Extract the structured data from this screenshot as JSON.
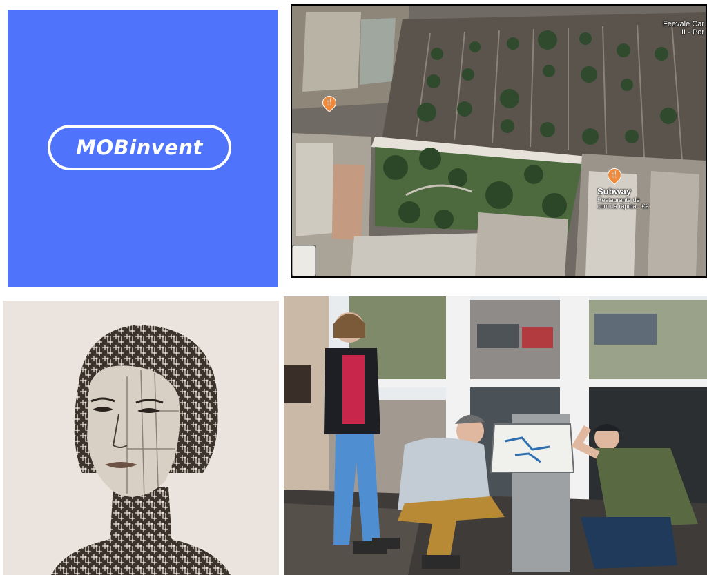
{
  "logo": {
    "text": "MOBinvent"
  },
  "map": {
    "corner_label": "Feevale Car\nII - Por",
    "place_name": "Subway",
    "place_category": "Restaurante de\ncomida rápida · €€",
    "pin_icon": "restaurant-icon"
  },
  "portrait": {
    "description_icon": "circuit-face-illustration"
  },
  "photo": {
    "description_icon": "group-photo"
  },
  "colors": {
    "logo_bg": "#4f74fb",
    "portrait_bg": "#ebe4de",
    "pin": "#f08a3a"
  }
}
